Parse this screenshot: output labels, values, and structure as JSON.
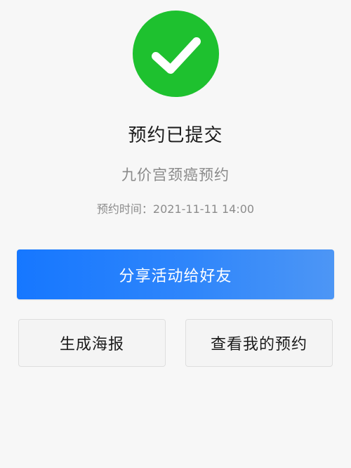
{
  "status": {
    "icon": "checkmark-icon",
    "color": "#1ec12f",
    "title": "预约已提交"
  },
  "appointment": {
    "name": "九价宫颈癌预约",
    "time_label": "预约时间：",
    "time_value": "2021-11-11 14:00"
  },
  "actions": {
    "share_label": "分享活动给好友",
    "share_color": "#1677ff",
    "poster_label": "生成海报",
    "my_booking_label": "查看我的预约"
  }
}
